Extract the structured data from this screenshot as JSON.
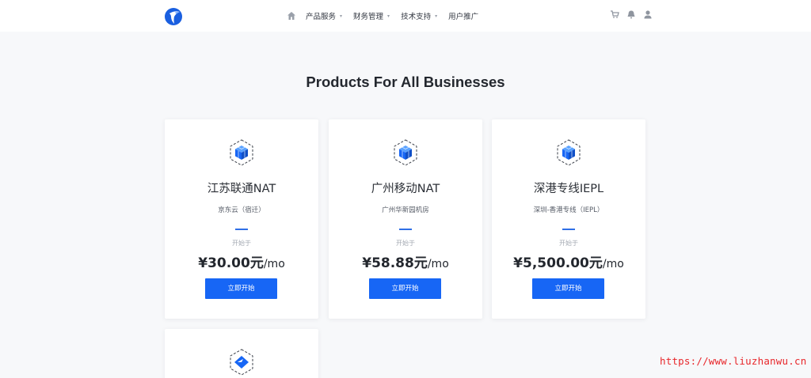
{
  "colors": {
    "accent": "#1766f5",
    "title": "#23272e",
    "watermark": "#e8262a"
  },
  "header": {
    "logo_icon": "bird-logo-icon",
    "home_icon": "home-icon",
    "nav": [
      {
        "label": "产品服务",
        "caret": "▾"
      },
      {
        "label": "财务管理",
        "caret": "▾"
      },
      {
        "label": "技术支持",
        "caret": "▾"
      },
      {
        "label": "用户推广",
        "caret": ""
      }
    ],
    "right_icons": [
      "cart-icon",
      "bell-icon",
      "user-icon"
    ]
  },
  "page_title": "Products For All Businesses",
  "products": [
    {
      "icon": "cube-stack-icon",
      "title": "江苏联通NAT",
      "subtitle": "京东云（宿迁）",
      "from_label": "开始于",
      "price": "¥30.00元",
      "unit": "/mo",
      "button": "立即开始"
    },
    {
      "icon": "cube-stack-icon",
      "title": "广州移动NAT",
      "subtitle": "广州华新园机房",
      "from_label": "开始于",
      "price": "¥58.88元",
      "unit": "/mo",
      "button": "立即开始"
    },
    {
      "icon": "cube-stack-icon",
      "title": "深港专线IEPL",
      "subtitle": "深圳-香港专线（IEPL）",
      "from_label": "开始于",
      "price": "¥5,500.00元",
      "unit": "/mo",
      "button": "立即开始"
    },
    {
      "icon": "diamond-box-icon"
    }
  ],
  "watermark": "https://www.liuzhanwu.cn"
}
